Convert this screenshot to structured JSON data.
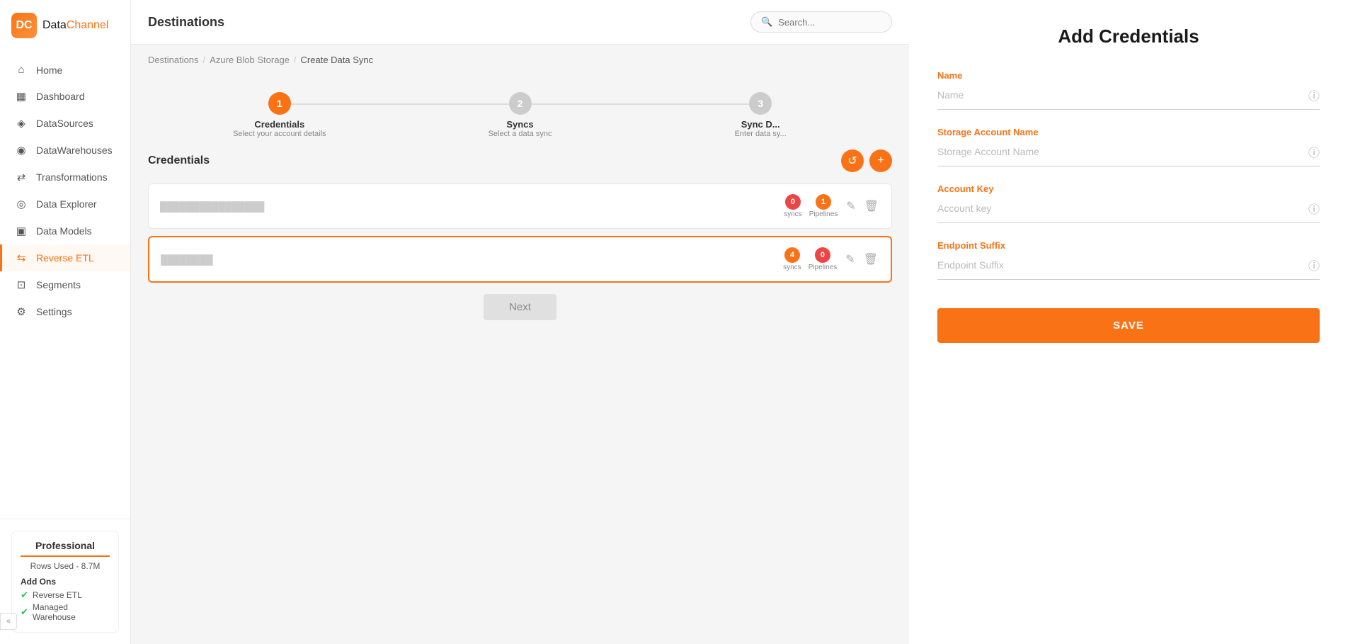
{
  "app": {
    "logo_data": "Data",
    "logo_channel": "Channel"
  },
  "sidebar": {
    "items": [
      {
        "id": "home",
        "label": "Home",
        "icon": "⌂"
      },
      {
        "id": "dashboard",
        "label": "Dashboard",
        "icon": "▦"
      },
      {
        "id": "datasources",
        "label": "DataSources",
        "icon": "◈"
      },
      {
        "id": "datawarehouses",
        "label": "DataWarehouses",
        "icon": "◉"
      },
      {
        "id": "transformations",
        "label": "Transformations",
        "icon": "⇄"
      },
      {
        "id": "data-explorer",
        "label": "Data Explorer",
        "icon": "◎"
      },
      {
        "id": "data-models",
        "label": "Data Models",
        "icon": "▣"
      },
      {
        "id": "reverse-etl",
        "label": "Reverse ETL",
        "icon": "⇆",
        "active": true
      },
      {
        "id": "segments",
        "label": "Segments",
        "icon": "⊡"
      },
      {
        "id": "settings",
        "label": "Settings",
        "icon": "⚙"
      }
    ],
    "plan": {
      "title": "Professional",
      "rows_label": "Rows Used - 8.7M",
      "addons_title": "Add Ons",
      "addons": [
        {
          "label": "Reverse ETL"
        },
        {
          "label": "Managed Warehouse"
        }
      ]
    },
    "collapse_icon": "«"
  },
  "header": {
    "title": "Destinations",
    "search_placeholder": "Search..."
  },
  "breadcrumb": {
    "items": [
      {
        "label": "Destinations",
        "link": true
      },
      {
        "label": "Azure Blob Storage",
        "link": true
      },
      {
        "label": "Create Data Sync",
        "link": false
      }
    ]
  },
  "steps": [
    {
      "number": "1",
      "label": "Credentials",
      "sublabel": "Select your account details",
      "state": "active"
    },
    {
      "number": "2",
      "label": "Syncs",
      "sublabel": "Select a data sync",
      "state": "inactive"
    },
    {
      "number": "3",
      "label": "Sync D...",
      "sublabel": "Enter data sy...",
      "state": "inactive"
    }
  ],
  "credentials_section": {
    "title": "Credentials",
    "refresh_icon": "↺",
    "add_icon": "+",
    "items": [
      {
        "id": "cred1",
        "name": "••••••••••••••",
        "syncs_count": "0",
        "pipelines_count": "1",
        "selected": false
      },
      {
        "id": "cred2",
        "name": "••••••••",
        "syncs_count": "4",
        "pipelines_count": "0",
        "selected": true
      }
    ],
    "next_button_label": "Next"
  },
  "add_credentials_panel": {
    "title": "Add Credentials",
    "fields": [
      {
        "id": "name",
        "label": "Name",
        "placeholder": "Name"
      },
      {
        "id": "storage-account-name",
        "label": "Storage Account Name",
        "placeholder": "Storage Account Name"
      },
      {
        "id": "account-key",
        "label": "Account Key",
        "placeholder": "Account key"
      },
      {
        "id": "endpoint-suffix",
        "label": "Endpoint Suffix",
        "placeholder": "Endpoint Suffix"
      }
    ],
    "save_button_label": "SAVE"
  }
}
